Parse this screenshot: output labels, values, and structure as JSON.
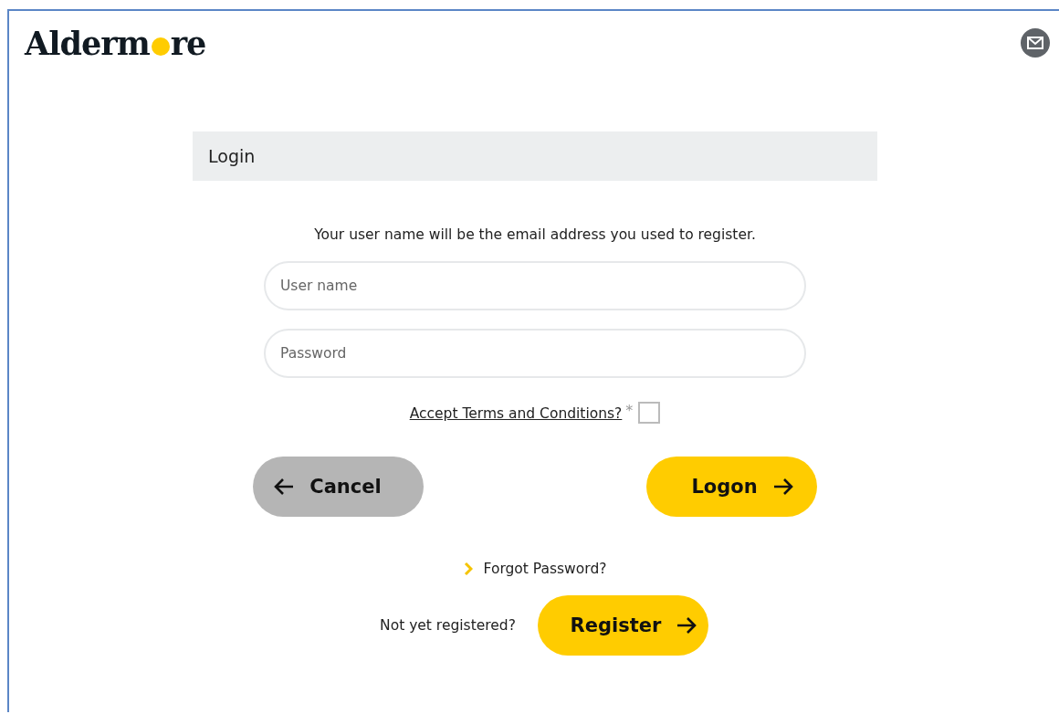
{
  "logo": {
    "before_dot": "Alderm",
    "after_dot": "re"
  },
  "panel": {
    "title": "Login"
  },
  "form": {
    "instruction": "Your user name will be the email address you used to register.",
    "fields": [
      {
        "placeholder": "User name"
      },
      {
        "placeholder": "Password"
      }
    ],
    "terms": {
      "label": "Accept Terms and Conditions?",
      "required_mark": "*",
      "checked": false
    },
    "cancel_button": "Cancel",
    "logon_button": "Logon",
    "forgot_link": "Forgot Password?",
    "register_prompt": "Not yet registered?",
    "register_button": "Register"
  }
}
